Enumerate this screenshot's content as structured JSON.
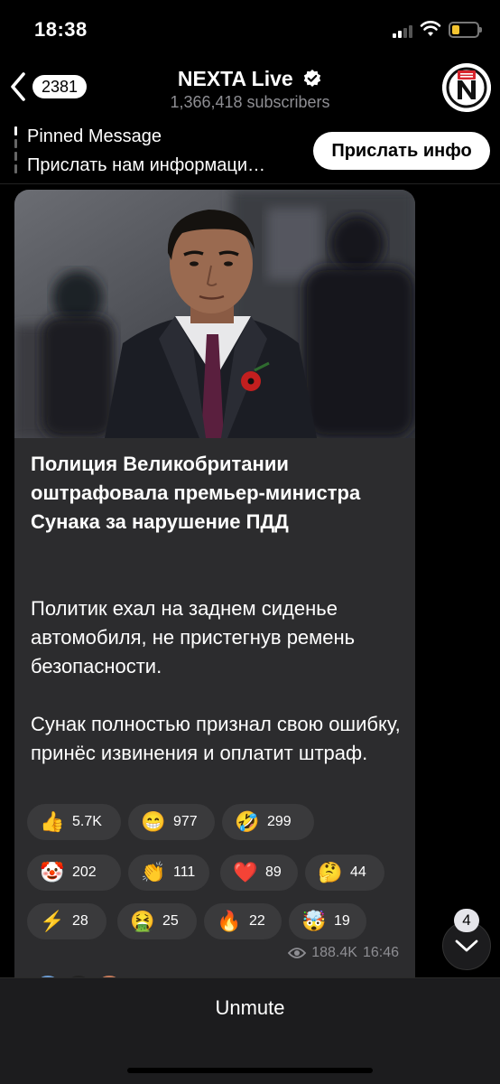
{
  "status_bar": {
    "time": "18:38"
  },
  "header": {
    "back_badge": "2381",
    "title": "NEXTA Live",
    "subscribers": "1,366,418 subscribers"
  },
  "pinned": {
    "title": "Pinned Message",
    "text": "Прислать нам информаци…",
    "action_label": "Прислать инфо"
  },
  "message": {
    "headline": "Полиция Великобритании оштрафовала премьер-министра Сунака за нарушение ПДД",
    "paragraph_1": "Политик ехал на заднем сиденье автомобиля, не пристегнув ремень безопасности.",
    "paragraph_2": "Сунак полностью признал свою ошибку, принёс извинения и оплатит штраф.",
    "reactions": [
      {
        "emoji": "👍",
        "count": "5.7K"
      },
      {
        "emoji": "😁",
        "count": "977"
      },
      {
        "emoji": "🤣",
        "count": "299"
      },
      {
        "emoji": "🤡",
        "count": "202"
      },
      {
        "emoji": "👏",
        "count": "111"
      },
      {
        "emoji": "❤️",
        "count": "89"
      },
      {
        "emoji": "🤔",
        "count": "44"
      },
      {
        "emoji": "⚡",
        "count": "28"
      },
      {
        "emoji": "🤮",
        "count": "25"
      },
      {
        "emoji": "🔥",
        "count": "22"
      },
      {
        "emoji": "🤯",
        "count": "19"
      }
    ],
    "views": "188.4K",
    "time": "16:46"
  },
  "scroll_down": {
    "badge": "4"
  },
  "bottom_bar": {
    "label": "Unmute"
  }
}
